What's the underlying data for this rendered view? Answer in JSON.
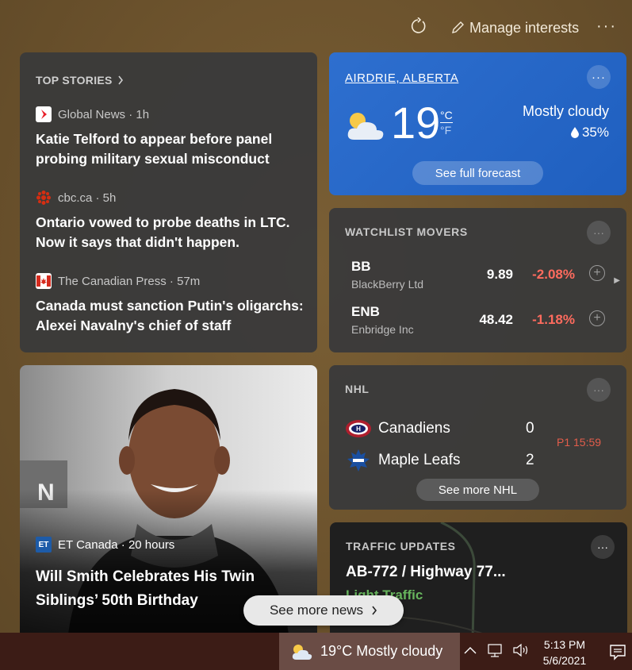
{
  "header": {
    "manage_label": "Manage interests",
    "more_label": "···"
  },
  "top_stories": {
    "title": "TOP STORIES",
    "stories": [
      {
        "source": "Global News · 1h",
        "headline": "Katie Telford to appear before panel probing military sexual misconduct",
        "logo_color": "#e8202a"
      },
      {
        "source": "cbc.ca · 5h",
        "headline": "Ontario vowed to probe deaths in LTC. Now it says that didn't happen.",
        "logo_color": "#d42e12"
      },
      {
        "source": "The Canadian Press · 57m",
        "headline": "Canada must sanction Putin's oligarchs: Alexei Navalny's chief of staff",
        "logo_color": "#d52b1e"
      }
    ]
  },
  "weather": {
    "location": "AIRDRIE, ALBERTA",
    "temp": "19",
    "unit_c": "°C",
    "unit_f": "°F",
    "condition": "Mostly cloudy",
    "precip": "35%",
    "button": "See full forecast",
    "more": "···"
  },
  "watchlist": {
    "title": "WATCHLIST MOVERS",
    "more": "···",
    "stocks": [
      {
        "symbol": "BB",
        "name": "BlackBerry Ltd",
        "price": "9.89",
        "change": "-2.08%"
      },
      {
        "symbol": "ENB",
        "name": "Enbridge Inc",
        "price": "48.42",
        "change": "-1.18%"
      }
    ]
  },
  "nhl": {
    "title": "NHL",
    "more": "···",
    "teams": [
      {
        "name": "Canadiens",
        "score": "0"
      },
      {
        "name": "Maple Leafs",
        "score": "2"
      }
    ],
    "status": "P1 15:59",
    "button": "See more NHL"
  },
  "traffic": {
    "title": "TRAFFIC UPDATES",
    "more": "···",
    "road": "AB-772 / Highway 77...",
    "status": "Light Traffic"
  },
  "photo_story": {
    "source": "ET Canada · 20 hours",
    "logo_text": "ET",
    "headline": "Will Smith Celebrates His Twin Siblings’ 50th Birthday"
  },
  "see_more": "See more news",
  "taskbar": {
    "weather_text": "19°C  Mostly cloudy",
    "time": "5:13 PM",
    "date": "5/6/2021"
  },
  "colors": {
    "accent_blue": "#2669cc",
    "negative": "#ff6b5e",
    "traffic_green": "#67b45d",
    "taskbar": "#3c1c16"
  }
}
